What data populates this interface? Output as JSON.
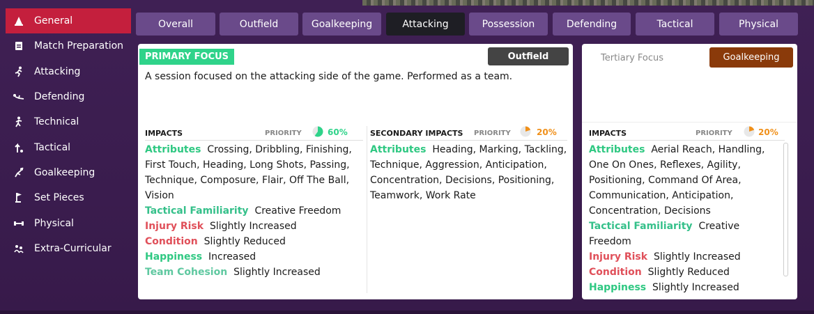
{
  "sidebar": {
    "items": [
      {
        "label": "General",
        "icon": "cone-icon"
      },
      {
        "label": "Match Preparation",
        "icon": "clipboard-icon"
      },
      {
        "label": "Attacking",
        "icon": "runner-icon"
      },
      {
        "label": "Defending",
        "icon": "slide-tackle-icon"
      },
      {
        "label": "Technical",
        "icon": "dribble-icon"
      },
      {
        "label": "Tactical",
        "icon": "tactics-icon"
      },
      {
        "label": "Goalkeeping",
        "icon": "goalkeeper-icon"
      },
      {
        "label": "Set Pieces",
        "icon": "flag-icon"
      },
      {
        "label": "Physical",
        "icon": "dumbbell-icon"
      },
      {
        "label": "Extra-Curricular",
        "icon": "people-icon"
      }
    ]
  },
  "tabs": [
    "Overall",
    "Outfield",
    "Goalkeeping",
    "Attacking",
    "Possession",
    "Defending",
    "Tactical",
    "Physical"
  ],
  "primary": {
    "badge": "PRIMARY FOCUS",
    "type": "Outfield",
    "description": "A session focused on the attacking side of the game. Performed as a team.",
    "impacts": {
      "title": "IMPACTS",
      "priority_label": "PRIORITY",
      "priority": "60%",
      "priority_fraction": 0.6,
      "attributes_label": "Attributes",
      "attr_lines": [
        "Crossing, Dribbling, Finishing,",
        "First Touch, Heading, Long Shots, Passing,",
        "Technique, Composure, Flair, Off The Ball,",
        "Vision"
      ],
      "tactical_label": "Tactical Familiarity",
      "tactical_value": "Creative Freedom",
      "injury_label": "Injury Risk",
      "injury_value": "Slightly Increased",
      "condition_label": "Condition",
      "condition_value": "Slightly Reduced",
      "happiness_label": "Happiness",
      "happiness_value": "Increased",
      "cohesion_label": "Team Cohesion",
      "cohesion_value": "Slightly Increased"
    },
    "secondary": {
      "title": "SECONDARY IMPACTS",
      "priority_label": "PRIORITY",
      "priority": "20%",
      "priority_fraction": 0.2,
      "attributes_label": "Attributes",
      "attr_lines": [
        "Heading, Marking, Tackling,",
        "Technique, Aggression, Anticipation,",
        "Concentration, Decisions, Positioning,",
        "Teamwork, Work Rate"
      ]
    }
  },
  "tertiary": {
    "label": "Tertiary Focus",
    "type": "Goalkeeping",
    "impacts": {
      "title": "IMPACTS",
      "priority_label": "PRIORITY",
      "priority": "20%",
      "priority_fraction": 0.2,
      "attributes_label": "Attributes",
      "attr_lines": [
        "Aerial Reach, Handling,",
        "One On Ones, Reflexes, Agility,",
        "Positioning, Command Of Area,",
        "Communication, Anticipation,",
        "Concentration, Decisions"
      ],
      "tactical_label": "Tactical Familiarity",
      "tactical_value_1": "Creative",
      "tactical_value_2": "Freedom",
      "injury_label": "Injury Risk",
      "injury_value": "Slightly Increased",
      "condition_label": "Condition",
      "condition_value": "Slightly Reduced",
      "happiness_label": "Happiness",
      "happiness_value": "Slightly Increased"
    }
  },
  "colors": {
    "accent": "#c41f3d",
    "tab": "#6a4a8a",
    "tab_active": "#1e1e24",
    "focus": "#2fd38a",
    "gk": "#8a3a0a",
    "priority_green": "#2fd38a",
    "priority_orange": "#f0901a"
  }
}
